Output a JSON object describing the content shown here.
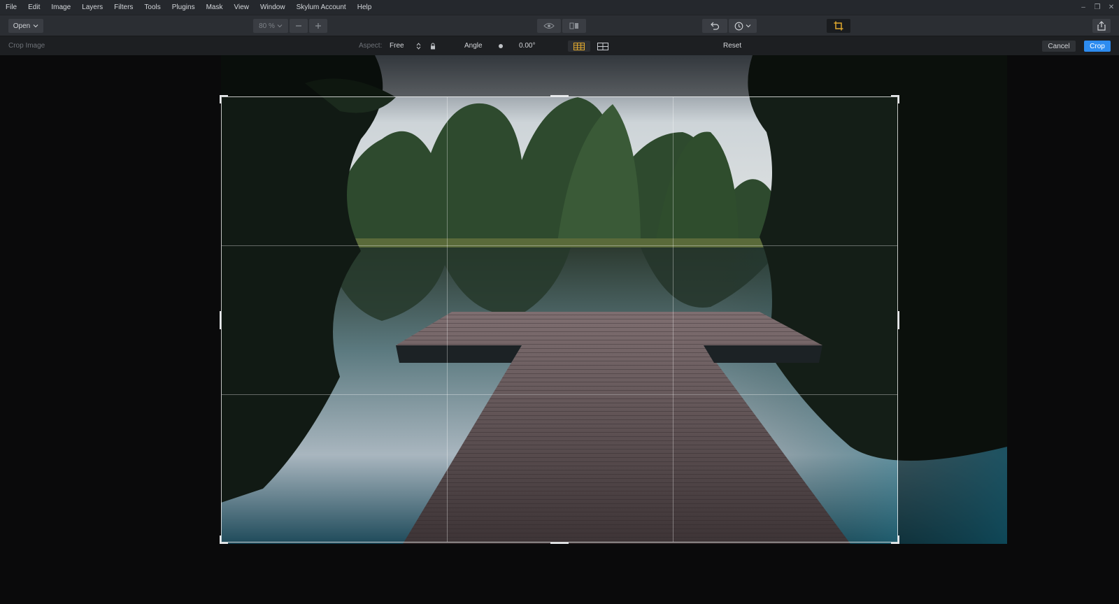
{
  "menu": [
    "File",
    "Edit",
    "Image",
    "Layers",
    "Filters",
    "Tools",
    "Plugins",
    "Mask",
    "View",
    "Window",
    "Skylum Account",
    "Help"
  ],
  "window_controls": {
    "minimize": "–",
    "restore": "❐",
    "close": "✕"
  },
  "toolbar": {
    "open_label": "Open",
    "zoom_value": "80 %",
    "icons": [
      "chevron-down-icon",
      "minus-icon",
      "plus-icon",
      "eye-icon",
      "compare-icon",
      "undo-icon",
      "history-icon",
      "crop-icon",
      "share-icon"
    ]
  },
  "cropbar": {
    "title": "Crop Image",
    "aspect_label": "Aspect:",
    "aspect_value": "Free",
    "angle_label": "Angle",
    "angle_value": "0.00°",
    "reset_label": "Reset",
    "cancel_label": "Cancel",
    "crop_label": "Crop"
  },
  "colors": {
    "accent": "#2d8cf0",
    "crop_icon": "#e0a82e",
    "grid_active": "#e0a82e"
  }
}
